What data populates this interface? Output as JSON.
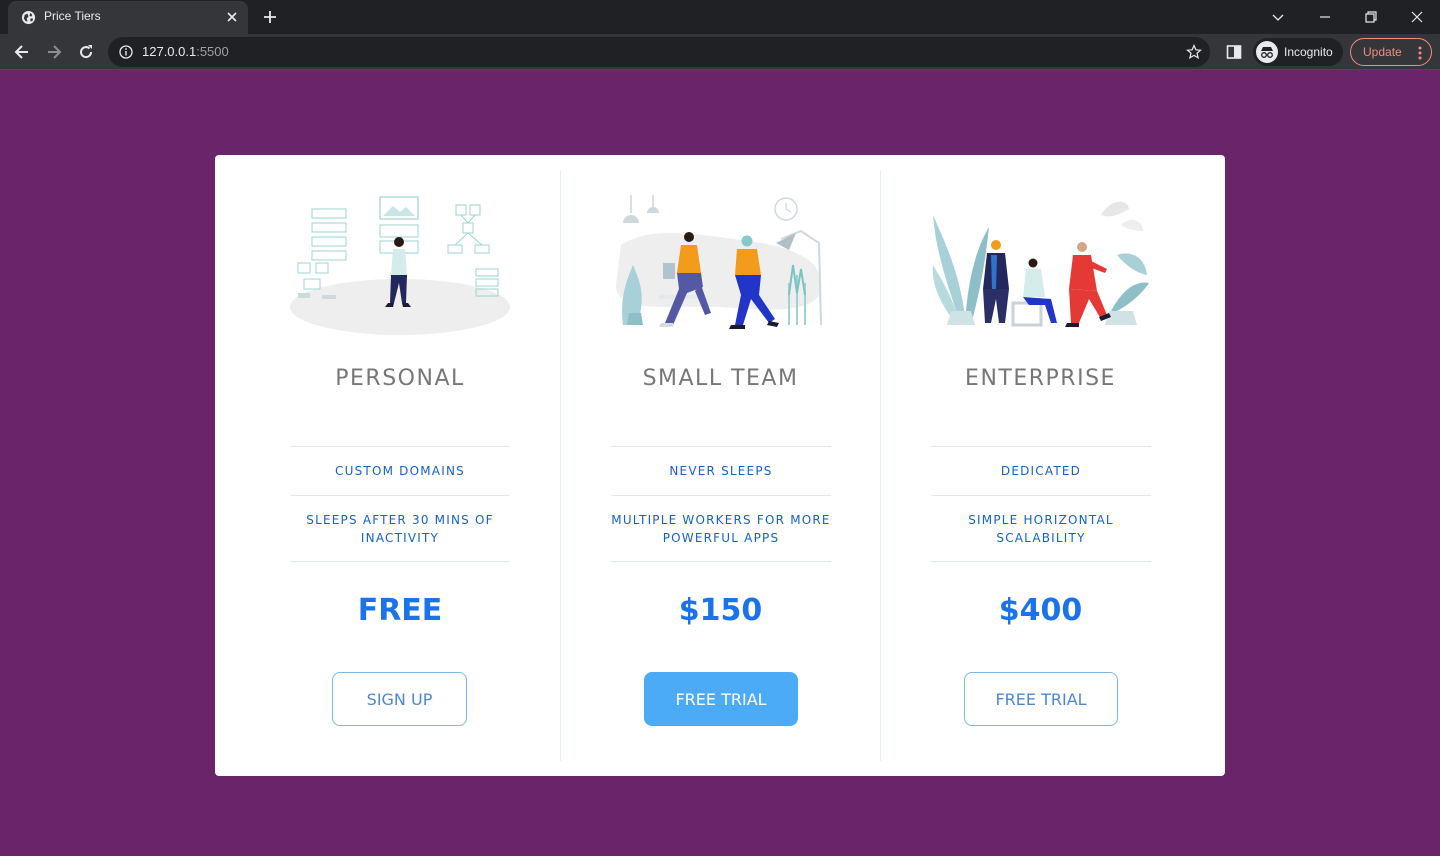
{
  "browser": {
    "tab_title": "Price Tiers",
    "url_host": "127.0.0.1",
    "url_port": ":5500",
    "profile_label": "Incognito",
    "update_label": "Update",
    "icons": [
      "globe-icon",
      "close-icon",
      "plus-icon",
      "chevron-down-icon",
      "minimize-icon",
      "restore-icon",
      "close-window-icon",
      "back-arrow-icon",
      "forward-arrow-icon",
      "reload-icon",
      "info-icon",
      "star-icon",
      "side-panel-icon",
      "incognito-icon",
      "kebab-menu-icon"
    ]
  },
  "colors": {
    "page_background": "#6a2469",
    "card_background": "#ffffff",
    "tier_name": "#777777",
    "feature_text": "#1363c8",
    "price": "#1a73e8",
    "primary_button": "#4cabf7"
  },
  "tiers": [
    {
      "name": "PERSONAL",
      "features": [
        "CUSTOM DOMAINS",
        "SLEEPS AFTER 30 MINS OF INACTIVITY"
      ],
      "price": "FREE",
      "button": "SIGN UP",
      "button_style": "outline",
      "illustration": "person-with-dashboards-illustration"
    },
    {
      "name": "SMALL TEAM",
      "features": [
        "NEVER SLEEPS",
        "MULTIPLE WORKERS FOR MORE POWERFUL APPS"
      ],
      "price": "$150",
      "button": "FREE TRIAL",
      "button_style": "filled",
      "illustration": "two-people-walking-illustration"
    },
    {
      "name": "ENTERPRISE",
      "features": [
        "DEDICATED",
        "SIMPLE HORIZONTAL SCALABILITY"
      ],
      "price": "$400",
      "button": "FREE TRIAL",
      "button_style": "outline",
      "illustration": "three-people-meeting-illustration"
    }
  ]
}
